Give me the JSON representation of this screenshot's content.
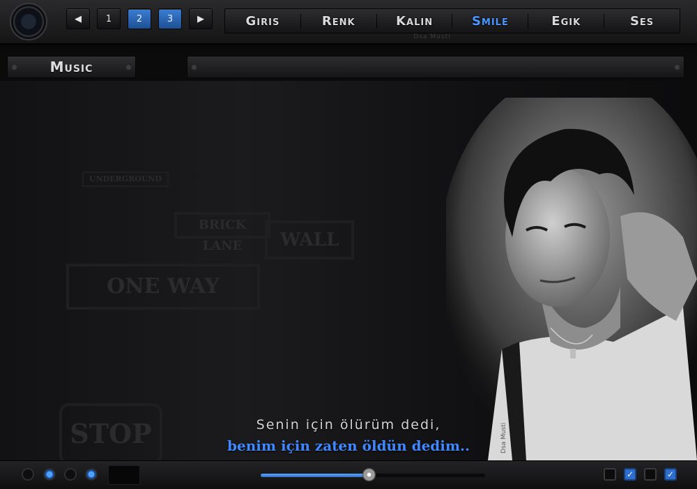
{
  "pager": {
    "prev_icon": "arrow-left-icon",
    "pages": [
      "1",
      "2",
      "3"
    ],
    "active_pages": [
      "2",
      "3"
    ],
    "next_icon": "arrow-right-icon"
  },
  "nav": {
    "items": [
      "Giris",
      "Renk",
      "Kalın",
      "Smile",
      "Egik",
      "Ses"
    ],
    "active": "Smile"
  },
  "credit": "Dsa Musti",
  "music_label": "Music",
  "background_signs": [
    "ONE WAY",
    "BRICK LANE",
    "WALL",
    "UNDERGROUND",
    "STOP"
  ],
  "quote": {
    "line1": "Senin için ölürüm dedi,",
    "line2": "benim için zaten öldün dedim.."
  },
  "watermark": "Dsa Musti",
  "player": {
    "radio_states": [
      false,
      true,
      false,
      true
    ],
    "progress": 0.48,
    "checkbox_states": [
      false,
      true,
      false,
      true
    ]
  },
  "colors": {
    "accent": "#3f88ff",
    "background": "#0b0b0c"
  }
}
